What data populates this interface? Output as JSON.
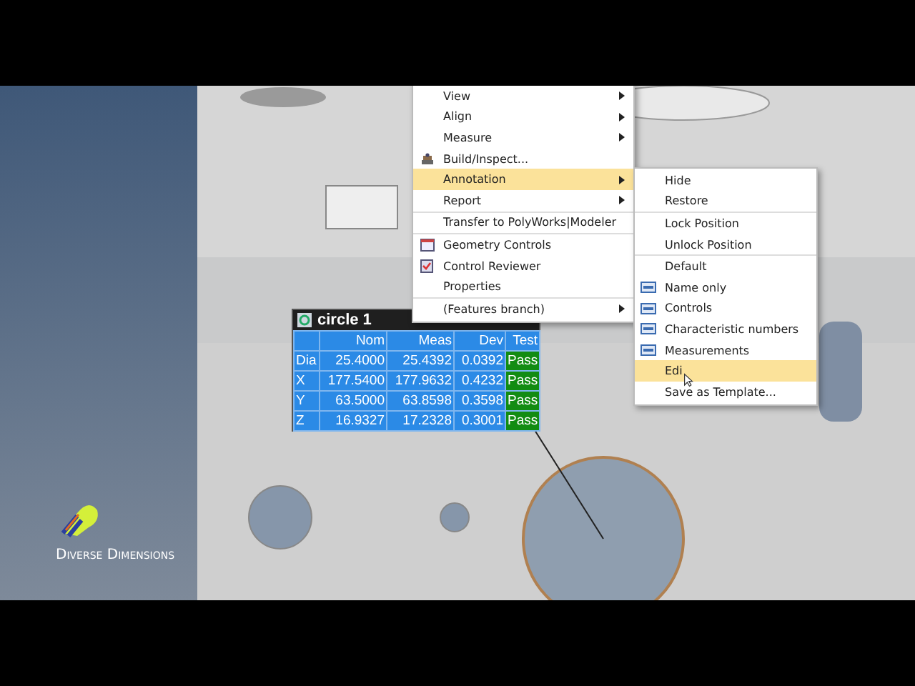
{
  "logo": {
    "text": "Diverse Dimensions"
  },
  "context_menu": {
    "groups": [
      [
        {
          "label": "View",
          "kind": "plain",
          "submenu": true,
          "selected": false
        },
        {
          "label": "Align",
          "kind": "plain",
          "submenu": true,
          "selected": false
        },
        {
          "label": "Measure",
          "kind": "plain",
          "submenu": true,
          "selected": false
        },
        {
          "label": "Build/Inspect...",
          "kind": "build",
          "submenu": false,
          "selected": false
        },
        {
          "label": "Annotation",
          "kind": "plain",
          "submenu": true,
          "selected": true
        },
        {
          "label": "Report",
          "kind": "plain",
          "submenu": true,
          "selected": false
        }
      ],
      [
        {
          "label": "Transfer to PolyWorks|Modeler",
          "kind": "plain",
          "submenu": false,
          "selected": false
        }
      ],
      [
        {
          "label": "Geometry Controls",
          "kind": "geometry",
          "submenu": false,
          "selected": false
        },
        {
          "label": "Control Reviewer",
          "kind": "reviewer",
          "submenu": false,
          "selected": false
        },
        {
          "label": "Properties",
          "kind": "plain",
          "submenu": false,
          "selected": false
        }
      ],
      [
        {
          "label": "(Features branch)",
          "kind": "plain",
          "submenu": true,
          "selected": false
        }
      ]
    ]
  },
  "submenu": {
    "groups": [
      [
        {
          "label": "Hide",
          "kind": "plain",
          "selected": false
        },
        {
          "label": "Restore",
          "kind": "plain",
          "selected": false
        }
      ],
      [
        {
          "label": "Lock Position",
          "kind": "plain",
          "selected": false
        },
        {
          "label": "Unlock Position",
          "kind": "plain",
          "selected": false
        }
      ],
      [
        {
          "label": "Default",
          "kind": "plain",
          "selected": false
        },
        {
          "label": "Name only",
          "kind": "std",
          "selected": false
        },
        {
          "label": "Controls",
          "kind": "std",
          "selected": false
        },
        {
          "label": "Characteristic numbers",
          "kind": "std",
          "selected": false
        },
        {
          "label": "Measurements",
          "kind": "std",
          "selected": false
        },
        {
          "label": "Edi",
          "kind": "plain",
          "selected": true
        },
        {
          "label": "Save as Template...",
          "kind": "plain",
          "selected": false
        }
      ]
    ]
  },
  "annotation": {
    "title": "circle 1",
    "columns": [
      "Nom",
      "Meas",
      "Dev",
      "Test"
    ],
    "rows": [
      {
        "name": "Dia",
        "nom": "25.4000",
        "meas": "25.4392",
        "dev": "0.0392",
        "test": "Pass"
      },
      {
        "name": "X",
        "nom": "177.5400",
        "meas": "177.9632",
        "dev": "0.4232",
        "test": "Pass"
      },
      {
        "name": "Y",
        "nom": "63.5000",
        "meas": "63.8598",
        "dev": "0.3598",
        "test": "Pass"
      },
      {
        "name": "Z",
        "nom": "16.9327",
        "meas": "17.2328",
        "dev": "0.3001",
        "test": "Pass"
      }
    ]
  }
}
